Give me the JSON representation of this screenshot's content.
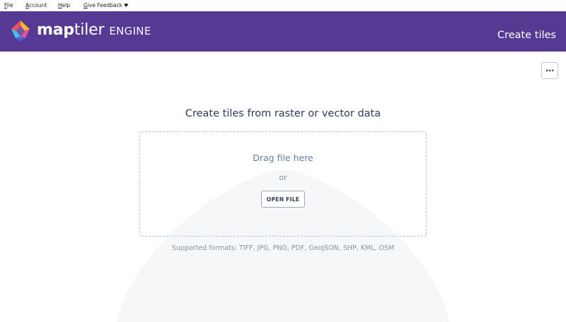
{
  "menu": {
    "items": [
      {
        "accel": "F",
        "rest": "ile"
      },
      {
        "accel": "A",
        "rest": "ccount"
      },
      {
        "accel": "H",
        "rest": "elp"
      },
      {
        "accel": "G",
        "rest": "ive Feedback"
      }
    ],
    "feedback_heart": "♥"
  },
  "header": {
    "brand_bold": "map",
    "brand_light": "tiler",
    "brand_product": "ENGINE",
    "page_title": "Create tiles",
    "background": "#563993"
  },
  "toolbar": {
    "more_label": "···"
  },
  "main": {
    "title": "Create tiles from raster or vector data",
    "drag_text": "Drag file here",
    "or_text": "or",
    "open_file_label": "OPEN FILE",
    "supported_formats": "Supported formats: TIFF, JPG, PNG, PDF, GeoJSON, SHP, KML, OSM"
  },
  "icons": {
    "logo": "maptiler-logo-icon",
    "more": "more-horizontal-icon"
  },
  "colors": {
    "accent": "#563993",
    "dropzone_border": "#a9c4e6",
    "text_dark": "#2e3b57"
  }
}
